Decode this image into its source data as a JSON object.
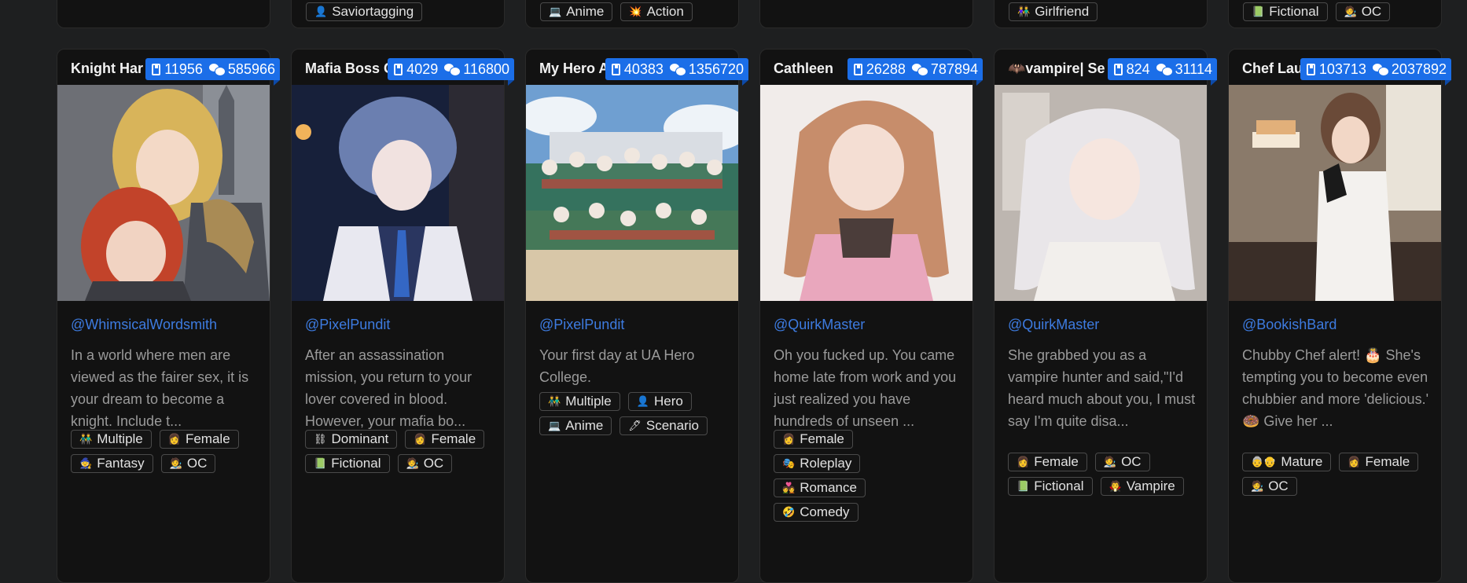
{
  "top_row": [
    {
      "tags": []
    },
    {
      "tags": [
        {
          "icon": "👤",
          "label": "Saviortagging"
        }
      ]
    },
    {
      "tags": [
        {
          "icon": "💻",
          "label": "Anime"
        },
        {
          "icon": "💥",
          "label": "Action"
        }
      ]
    },
    {
      "tags": []
    },
    {
      "tags": [
        {
          "icon": "👫",
          "label": "Girlfriend"
        }
      ]
    },
    {
      "tags": [
        {
          "icon": "📗",
          "label": "Fictional"
        },
        {
          "icon": "🧑‍🎨",
          "label": "OC"
        }
      ]
    }
  ],
  "cards": [
    {
      "name": "Knight Har",
      "stats": {
        "books": "11956",
        "chats": "585966"
      },
      "author": "@WhimsicalWordsmith",
      "description": "In a world where men are viewed as the fairer sex, it is your dream to become a knight. Include t...",
      "tags": [
        {
          "icon": "👬",
          "label": "Multiple"
        },
        {
          "icon": "👩",
          "label": "Female"
        },
        {
          "icon": "🧙",
          "label": "Fantasy"
        },
        {
          "icon": "🧑‍🎨",
          "label": "OC"
        }
      ],
      "image_colors": {
        "bg": "#6d6f75",
        "accent": "#d8b45a",
        "accent2": "#c2432a"
      }
    },
    {
      "name": "Mafia Boss G",
      "stats": {
        "books": "4029",
        "chats": "116800"
      },
      "author": "@PixelPundit",
      "description": "After an assassination mission, you return to your lover covered in blood. However, your mafia bo...",
      "tags": [
        {
          "icon": "⛓",
          "label": "Dominant"
        },
        {
          "icon": "👩",
          "label": "Female"
        },
        {
          "icon": "📗",
          "label": "Fictional"
        },
        {
          "icon": "🧑‍🎨",
          "label": "OC"
        }
      ],
      "image_colors": {
        "bg": "#17203a",
        "accent": "#6b7fb0",
        "accent2": "#e8e8f0"
      }
    },
    {
      "name": "My Hero A",
      "stats": {
        "books": "40383",
        "chats": "1356720"
      },
      "author": "@PixelPundit",
      "description": "Your first day at UA Hero College.",
      "tags": [
        {
          "icon": "👬",
          "label": "Multiple"
        },
        {
          "icon": "👤",
          "label": "Hero"
        },
        {
          "icon": "💻",
          "label": "Anime"
        },
        {
          "icon": "🖊",
          "label": "Scenario"
        }
      ],
      "image_colors": {
        "bg": "#6f9fd1",
        "accent": "#2b6a4a",
        "accent2": "#d8c7a8"
      }
    },
    {
      "name": "Cathleen",
      "stats": {
        "books": "26288",
        "chats": "787894"
      },
      "author": "@QuirkMaster",
      "description": "Oh you fucked up. You came home late from work and you just realized you have hundreds of unseen ...",
      "tags": [
        {
          "icon": "👩",
          "label": "Female"
        },
        {
          "icon": "🎭",
          "label": "Roleplay"
        },
        {
          "icon": "💑",
          "label": "Romance"
        },
        {
          "icon": "🤣",
          "label": "Comedy"
        }
      ],
      "image_colors": {
        "bg": "#f1ecea",
        "accent": "#c78d6b",
        "accent2": "#e9a7bd"
      }
    },
    {
      "name": "🦇vampire| Se",
      "stats": {
        "books": "824",
        "chats": "31114"
      },
      "author": "@QuirkMaster",
      "description": "She grabbed you as a vampire hunter and said,\"I'd heard much about you, I must say I'm quite disa...",
      "tags": [
        {
          "icon": "👩",
          "label": "Female"
        },
        {
          "icon": "🧑‍🎨",
          "label": "OC"
        },
        {
          "icon": "📗",
          "label": "Fictional"
        },
        {
          "icon": "🧛",
          "label": "Vampire"
        }
      ],
      "image_colors": {
        "bg": "#bdb6b0",
        "accent": "#e9e6e9",
        "accent2": "#f2efec"
      }
    },
    {
      "name": "Chef Lau",
      "stats": {
        "books": "103713",
        "chats": "2037892"
      },
      "author": "@BookishBard",
      "description": "Chubby Chef alert! 🎂 She's tempting you to become even chubbier and more 'delicious.' 🍩 Give her ...",
      "tags": [
        {
          "icon": "👵👴",
          "label": "Mature"
        },
        {
          "icon": "👩",
          "label": "Female"
        },
        {
          "icon": "🧑‍🎨",
          "label": "OC"
        }
      ],
      "image_colors": {
        "bg": "#8a7a6a",
        "accent": "#6a4a38",
        "accent2": "#f3f1ee"
      }
    }
  ]
}
